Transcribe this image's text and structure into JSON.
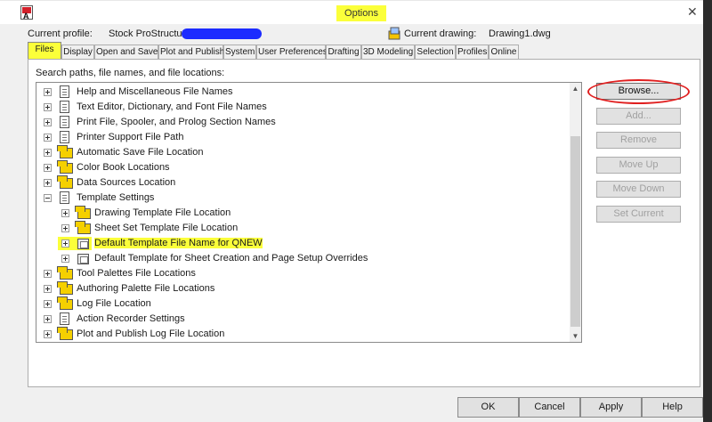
{
  "window": {
    "title": "Options",
    "close_glyph": "✕"
  },
  "header": {
    "profile_label": "Current profile:",
    "profile_value": "Stock ProStructure [",
    "drawing_label": "Current drawing:",
    "drawing_value": "Drawing1.dwg"
  },
  "tabs": [
    {
      "label": "Files",
      "active": true
    },
    {
      "label": "Display"
    },
    {
      "label": "Open and Save"
    },
    {
      "label": "Plot and Publish"
    },
    {
      "label": "System"
    },
    {
      "label": "User Preferences"
    },
    {
      "label": "Drafting"
    },
    {
      "label": "3D Modeling"
    },
    {
      "label": "Selection"
    },
    {
      "label": "Profiles"
    },
    {
      "label": "Online"
    }
  ],
  "files": {
    "section_label": "Search paths, file names, and file locations:",
    "tree": [
      {
        "label": "Help and Miscellaneous File Names",
        "icon": "document-icon",
        "level": 0,
        "expander": "plus"
      },
      {
        "label": "Text Editor, Dictionary, and Font File Names",
        "icon": "document-icon",
        "level": 0,
        "expander": "plus"
      },
      {
        "label": "Print File, Spooler, and Prolog Section Names",
        "icon": "document-icon",
        "level": 0,
        "expander": "plus"
      },
      {
        "label": "Printer Support File Path",
        "icon": "document-icon",
        "level": 0,
        "expander": "plus"
      },
      {
        "label": "Automatic Save File Location",
        "icon": "folder-icon",
        "level": 0,
        "expander": "plus"
      },
      {
        "label": "Color Book Locations",
        "icon": "folder-icon",
        "level": 0,
        "expander": "plus"
      },
      {
        "label": "Data Sources Location",
        "icon": "folder-icon",
        "level": 0,
        "expander": "plus"
      },
      {
        "label": "Template Settings",
        "icon": "settings-document-icon",
        "level": 0,
        "expander": "minus"
      },
      {
        "label": "Drawing Template File Location",
        "icon": "folder-icon",
        "level": 1,
        "expander": "plus"
      },
      {
        "label": "Sheet Set Template File Location",
        "icon": "folder-icon",
        "level": 1,
        "expander": "plus"
      },
      {
        "label": "Default Template File Name for QNEW",
        "icon": "template-file-icon",
        "level": 1,
        "expander": "plus",
        "highlighted": true
      },
      {
        "label": "Default Template for Sheet Creation and Page Setup Overrides",
        "icon": "template-file-icon",
        "level": 1,
        "expander": "plus"
      },
      {
        "label": "Tool Palettes File Locations",
        "icon": "folder-icon",
        "level": 0,
        "expander": "plus"
      },
      {
        "label": "Authoring Palette File Locations",
        "icon": "folder-icon",
        "level": 0,
        "expander": "plus"
      },
      {
        "label": "Log File Location",
        "icon": "folder-icon",
        "level": 0,
        "expander": "plus"
      },
      {
        "label": "Action Recorder Settings",
        "icon": "document-icon",
        "level": 0,
        "expander": "plus"
      },
      {
        "label": "Plot and Publish Log File Location",
        "icon": "folder-icon",
        "level": 0,
        "expander": "plus"
      }
    ]
  },
  "side_buttons": [
    {
      "label": "Browse...",
      "enabled": true
    },
    {
      "label": "Add...",
      "enabled": false
    },
    {
      "label": "Remove",
      "enabled": false
    },
    {
      "label": "Move Up",
      "enabled": false
    },
    {
      "label": "Move Down",
      "enabled": false
    },
    {
      "label": "Set Current",
      "enabled": false
    }
  ],
  "footer": {
    "ok": "OK",
    "cancel": "Cancel",
    "apply": "Apply",
    "help": "Help"
  },
  "colors": {
    "highlight": "#fbff3a",
    "annotation_circle": "#e02020",
    "redaction": "#1c2bff"
  }
}
